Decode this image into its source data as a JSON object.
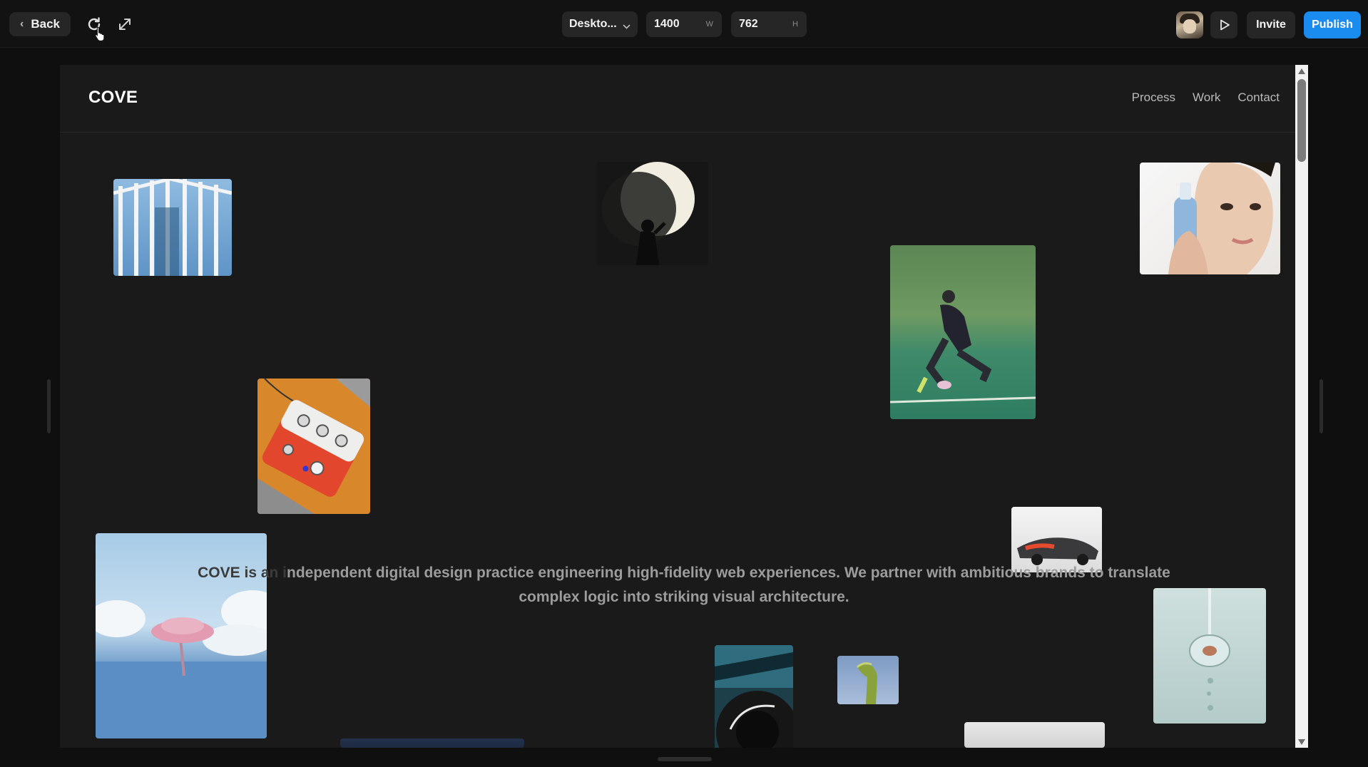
{
  "toolbar": {
    "back_label": "Back",
    "device_preset": "Deskto...",
    "width_value": "1400",
    "width_unit": "W",
    "height_value": "762",
    "height_unit": "H",
    "invite_label": "Invite",
    "publish_label": "Publish"
  },
  "site": {
    "logo": "COVE",
    "nav": [
      "Process",
      "Work",
      "Contact"
    ],
    "hero_faded": "COVE is an i",
    "hero_text": "ndependent digital design practice engineering high-fidelity web experiences. We partner with ambitious brands to translate complex logic into striking visual architecture."
  },
  "colors": {
    "accent": "#1a8cf0",
    "background": "#1a1a1a"
  },
  "icons": [
    "chevron-left-icon",
    "refresh-icon",
    "expand-icon",
    "chevron-down-icon",
    "play-icon"
  ]
}
